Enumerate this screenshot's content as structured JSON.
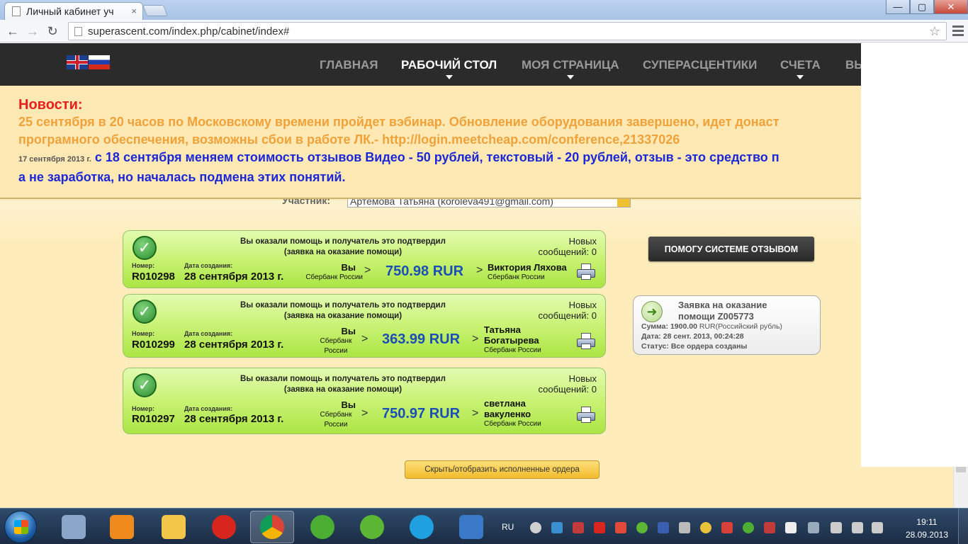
{
  "browser": {
    "tab_title": "Личный кабинет уч",
    "tab_close": "×",
    "url": "superascent.com/index.php/cabinet/index#",
    "win_min": "—",
    "win_max": "▢",
    "win_close": "✕",
    "back": "←",
    "forward": "→",
    "reload": "↻",
    "star": "☆"
  },
  "nav": {
    "items": [
      "ГЛАВНАЯ",
      "РАБОЧИЙ СТОЛ",
      "МОЯ СТРАНИЦА",
      "СУПЕРАСЦЕНТИКИ",
      "СЧЕТА",
      "ВЫ"
    ]
  },
  "news": {
    "title": "Новости:",
    "line1": "25 сентября в 20 часов по Московскому времени пройдет вэбинар. Обновление оборудования завершено, идет донаст",
    "line2": "програмного обеспечения, возможны сбои в работе ЛК.- http://login.meetcheap.com/conference,21337026",
    "date": "17 сентября 2013 г.",
    "line3": "с 18 сентября меняем стоимость отзывов Видео - 50 рублей, текстовый - 20 рублей, отзыв - это средство п",
    "line4": "а не заработка, но началась подмена этих понятий."
  },
  "participant": {
    "label": "Участник:",
    "value": "Артемова Татьяна (koroleva491@gmail.com)"
  },
  "orders": [
    {
      "msg1": "Вы оказали помощь и получатель это подтвердил",
      "msg2": "(заявка на оказание помощи)",
      "new_label": "Новых",
      "new_count": "сообщений: 0",
      "num_label": "Номер:",
      "number": "R010298",
      "date_label": "Дата создания:",
      "date": "28 сентября 2013 г.",
      "from": "Вы",
      "from_bank": "Сбербанк России",
      "amount": "750.98 RUR",
      "to_line1": "Виктория Ляхова",
      "to_line2": "",
      "to_bank": "Сбербанк России"
    },
    {
      "msg1": "Вы оказали помощь и получатель это подтвердил",
      "msg2": "(заявка на оказание помощи)",
      "new_label": "Новых",
      "new_count": "сообщений: 0",
      "num_label": "Номер:",
      "number": "R010299",
      "date_label": "Дата создания:",
      "date": "28 сентября 2013 г.",
      "from": "Вы",
      "from_bank": "Сбербанк России",
      "amount": "363.99 RUR",
      "to_line1": "Татьяна",
      "to_line2": "Богатырева",
      "to_bank": "Сбербанк России"
    },
    {
      "msg1": "Вы оказали помощь и получатель это подтвердил",
      "msg2": "(заявка на оказание помощи)",
      "new_label": "Новых",
      "new_count": "сообщений: 0",
      "num_label": "Номер:",
      "number": "R010297",
      "date_label": "Дата создания:",
      "date": "28 сентября 2013 г.",
      "from": "Вы",
      "from_bank": "Сбербанк России",
      "amount": "750.97 RUR",
      "to_line1": "светлана",
      "to_line2": "вакуленко",
      "to_bank": "Сбербанк России"
    }
  ],
  "help_button": "ПОМОГУ СИСТЕМЕ ОТЗЫВОМ",
  "request": {
    "title1": "Заявка на оказание",
    "title2": "помощи Z005773",
    "sum_label": "Сумма:",
    "sum_value": "1900.00",
    "sum_unit": "RUR(Российский рубль)",
    "date_label": "Дата:",
    "date_value": "28 сент. 2013, 00:24:28",
    "status_label": "Статус:",
    "status_value": "Все ордера созданы"
  },
  "toggle_button": "Скрыть/отобразить исполненные ордера",
  "taskbar": {
    "lang": "RU",
    "time": "19:11",
    "date": "28.09.2013"
  },
  "icon_colors": {
    "calculator": "#8aa6c8",
    "media": "#f08a1c",
    "explorer": "#f3c64a",
    "opera": "#d8251d",
    "chrome": "#3aa757",
    "utorrent": "#4caf33",
    "mail": "#5bb734",
    "skype": "#1fa0e0",
    "monitor": "#3a78c8"
  }
}
